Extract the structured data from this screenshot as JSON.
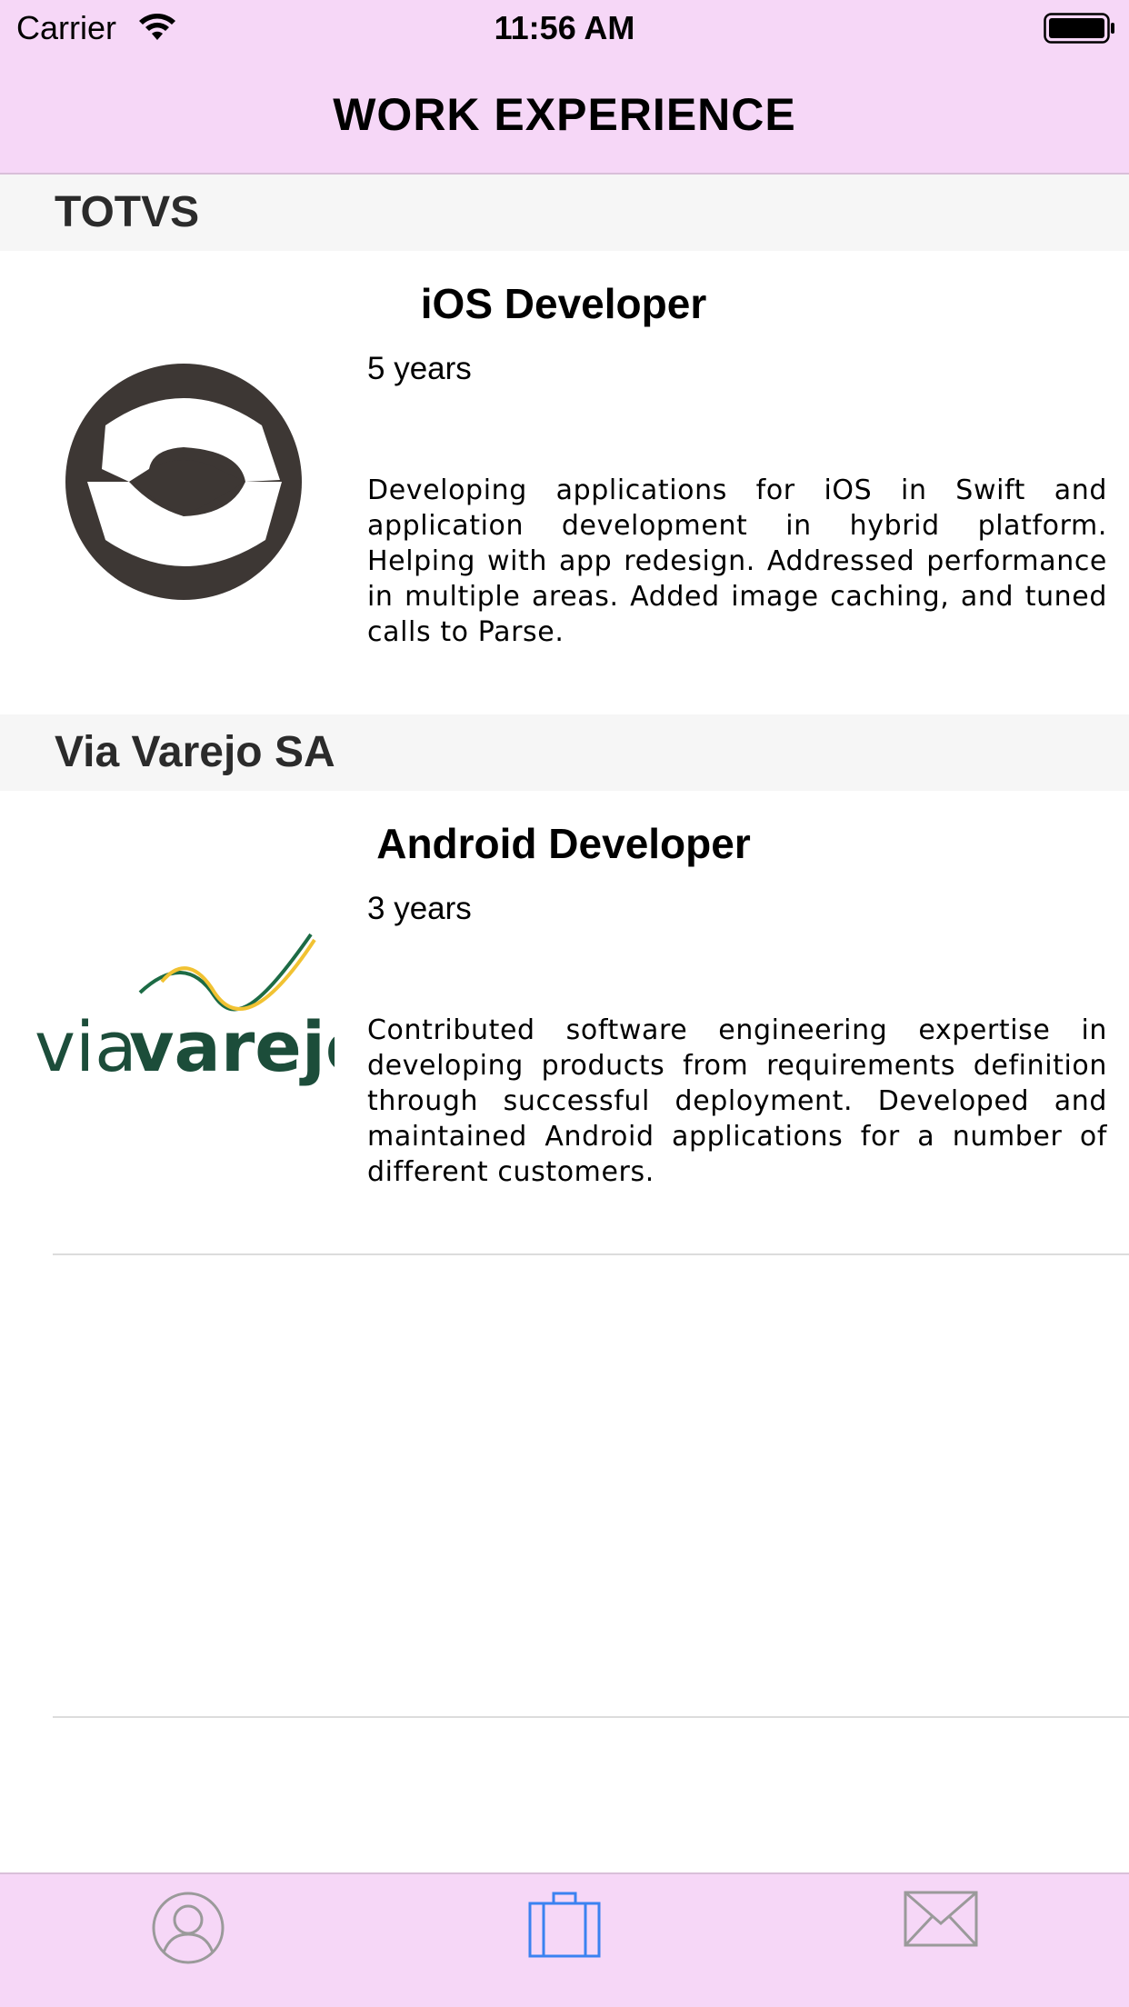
{
  "status_bar": {
    "carrier": "Carrier",
    "time": "11:56 AM"
  },
  "nav": {
    "title": "WORK EXPERIENCE"
  },
  "sections": [
    {
      "company": "TOTVS",
      "logo": "totvs-logo",
      "job_title": "iOS Developer",
      "duration": "5 years",
      "description": "Developing applications for iOS in Swift and application development in hybrid platform. Helping with app redesign. Addressed performance in multiple areas. Added image caching, and tuned calls to Parse."
    },
    {
      "company": "Via Varejo SA",
      "logo": "via-varejo-logo",
      "logo_text_light": "via",
      "logo_text_bold": "varejo",
      "job_title": "Android Developer",
      "duration": "3 years",
      "description": "Contributed software engineering expertise in developing products from requirements definition through successful deployment. Developed and maintained Android applications for a number of different customers."
    }
  ],
  "tab_bar": {
    "tabs": [
      {
        "icon": "person-icon",
        "selected": false
      },
      {
        "icon": "briefcase-icon",
        "selected": true
      },
      {
        "icon": "envelope-icon",
        "selected": false
      }
    ],
    "colors": {
      "selected": "#3b82f0",
      "unselected": "#9a9a9a",
      "background": "#f6d7f7"
    }
  }
}
